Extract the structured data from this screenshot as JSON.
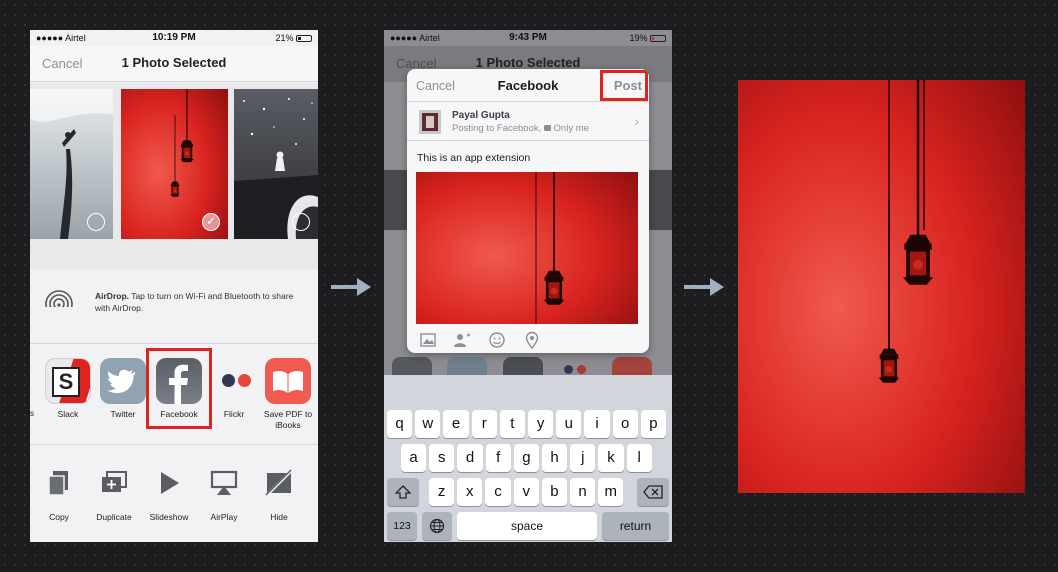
{
  "colors": {
    "background": "#1d1d1f",
    "highlight_red": "#e0231f",
    "ios_blue_gray": "#8a8f98",
    "keyboard_bg": "#d2d5db"
  },
  "screen1": {
    "status": {
      "carrier": "●●●●● Airtel",
      "time": "10:19 PM",
      "battery": "21%",
      "battery_level": 0.21
    },
    "header": {
      "cancel": "Cancel",
      "title": "1 Photo Selected"
    },
    "photos": [
      {
        "description_icon": "photo-thumb",
        "selected": false
      },
      {
        "description_icon": "photo-thumb",
        "selected": true
      },
      {
        "description_icon": "photo-thumb",
        "selected": false
      }
    ],
    "airdrop": {
      "title": "AirDrop.",
      "text": " Tap to turn on Wi-Fi and Bluetooth to share with AirDrop.",
      "icon": "airdrop-icon"
    },
    "apps": [
      {
        "label": "Slack",
        "icon": "slack-icon"
      },
      {
        "label": "Twitter",
        "icon": "twitter-icon"
      },
      {
        "label": "Facebook",
        "icon": "facebook-icon"
      },
      {
        "label": "Flickr",
        "icon": "flickr-icon"
      },
      {
        "label": "Save PDF to iBooks",
        "icon": "ibooks-icon"
      }
    ],
    "actions": [
      {
        "label": "Copy",
        "icon": "copy-icon"
      },
      {
        "label": "Duplicate",
        "icon": "duplicate-icon"
      },
      {
        "label": "Slideshow",
        "icon": "play-icon"
      },
      {
        "label": "AirPlay",
        "icon": "airplay-icon"
      },
      {
        "label": "Hide",
        "icon": "hide-icon"
      }
    ]
  },
  "screen2": {
    "status": {
      "carrier": "●●●●● Airtel",
      "time": "9:43 PM",
      "battery": "19%",
      "battery_level": 0.19
    },
    "background_header": {
      "cancel": "Cancel",
      "title": "1 Photo Selected"
    },
    "sheet": {
      "cancel": "Cancel",
      "title": "Facebook",
      "post": "Post",
      "account_name": "Payal Gupta",
      "posting_to": "Posting to Facebook,",
      "privacy": "Only me",
      "message": "This is an app extension",
      "tools": [
        "photo-icon",
        "tag-people-icon",
        "emoji-icon",
        "location-icon"
      ]
    },
    "keyboard": {
      "row1": [
        "q",
        "w",
        "e",
        "r",
        "t",
        "y",
        "u",
        "i",
        "o",
        "p"
      ],
      "row2": [
        "a",
        "s",
        "d",
        "f",
        "g",
        "h",
        "j",
        "k",
        "l"
      ],
      "row3": [
        "z",
        "x",
        "c",
        "v",
        "b",
        "n",
        "m"
      ],
      "numbers_key": "123",
      "space_key": "space",
      "return_key": "return"
    }
  }
}
